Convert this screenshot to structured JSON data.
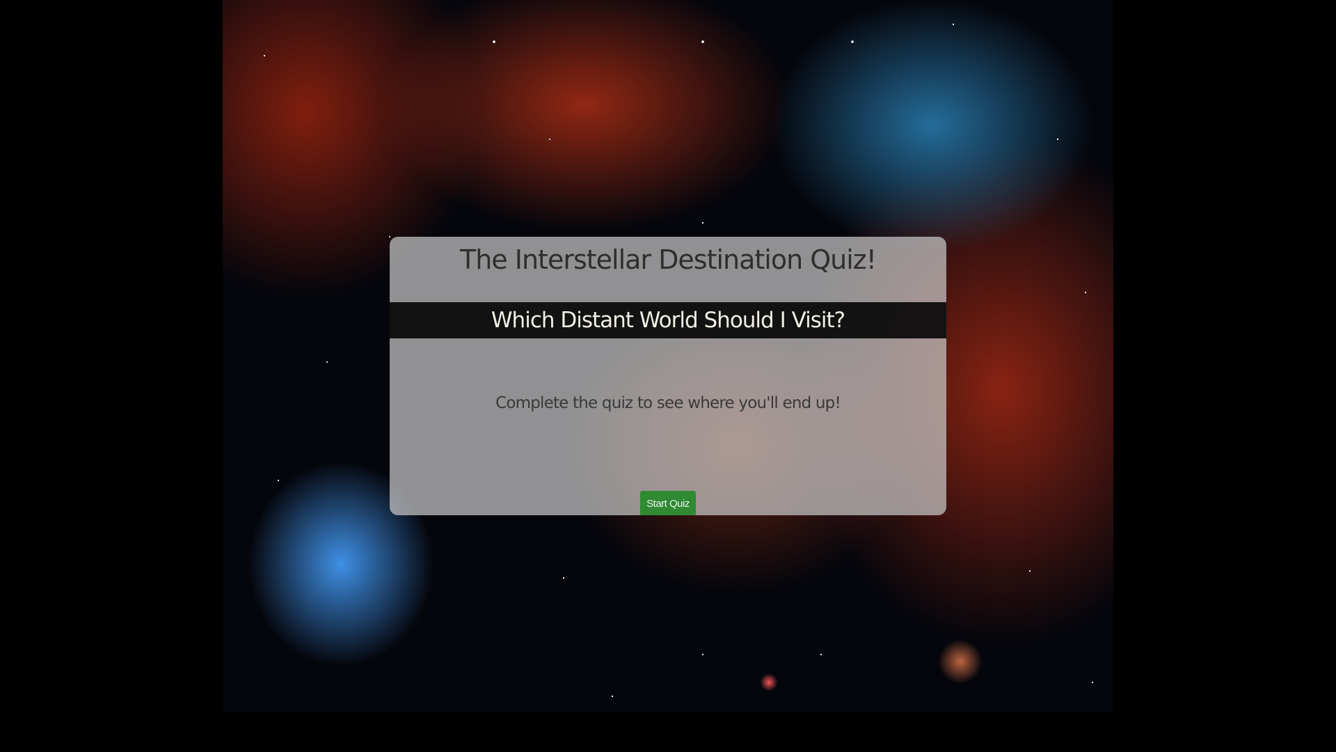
{
  "background": {
    "image": "space-nebula-background"
  },
  "quiz": {
    "title": "The Interstellar Destination Quiz!",
    "subtitle": "Which Distant World Should I Visit?",
    "description": "Complete the quiz to see where you'll end up!",
    "start_button_label": "Start Quiz"
  },
  "colors": {
    "page_background": "#000000",
    "card_background": "rgba(200,200,200,0.72)",
    "subtitle_bar": "#000000",
    "start_button": "#2f8a32",
    "title_text": "#2e2e2e",
    "subtitle_text": "#f2efe6"
  }
}
